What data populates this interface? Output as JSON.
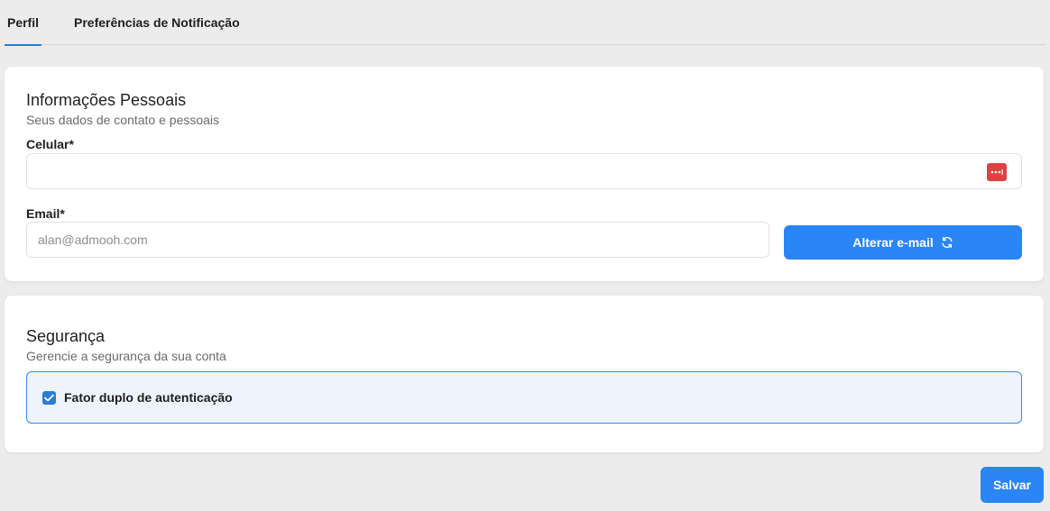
{
  "tabs": [
    {
      "label": "Perfil",
      "active": true
    },
    {
      "label": "Preferências de Notificação",
      "active": false
    }
  ],
  "personal": {
    "title": "Informações Pessoais",
    "subtitle": "Seus dados de contato e pessoais",
    "phone_label": "Celular*",
    "phone_value": "",
    "email_label": "Email*",
    "email_placeholder": "alan@admooh.com",
    "change_email_button": "Alterar e-mail",
    "change_email_icon": "refresh-icon",
    "password_manager_icon": "password-manager-icon"
  },
  "security": {
    "title": "Segurança",
    "subtitle": "Gerencie a segurança da sua conta",
    "two_factor_label": "Fator duplo de autenticação",
    "two_factor_checked": true
  },
  "actions": {
    "save_label": "Salvar"
  },
  "colors": {
    "accent": "#2a85f6",
    "background": "#ececec",
    "password_icon": "#e0403f"
  }
}
